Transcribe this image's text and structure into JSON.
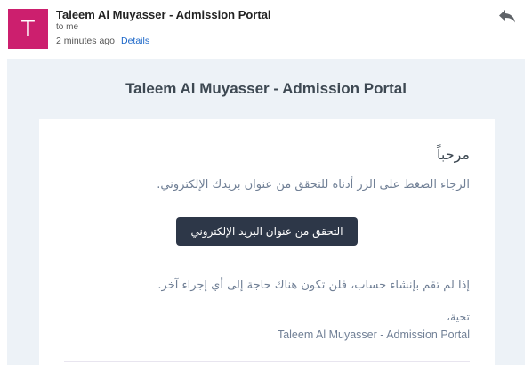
{
  "header": {
    "avatar_letter": "T",
    "sender": "Taleem Al Muyasser - Admission Portal",
    "to": "to me",
    "time": "2 minutes ago",
    "details": "Details",
    "reply_icon": "reply-icon"
  },
  "email": {
    "brand_title": "Taleem Al Muyasser - Admission Portal",
    "greeting": "مرحباً",
    "instruction": "الرجاء الضغط على الزر أدناه للتحقق من عنوان بريدك الإلكتروني.",
    "verify_button": "التحقق من عنوان البريد الإلكتروني",
    "ignore_text": "إذا لم تقم بإنشاء حساب، فلن تكون هناك حاجة إلى أي إجراء آخر.",
    "regards": "تحية،",
    "signature": "Taleem Al Muyasser - Admission Portal"
  },
  "colors": {
    "avatar": "#cc1f6e",
    "mail_background": "#edf2f7",
    "button": "#2d3748",
    "link": "#1a66c8"
  }
}
